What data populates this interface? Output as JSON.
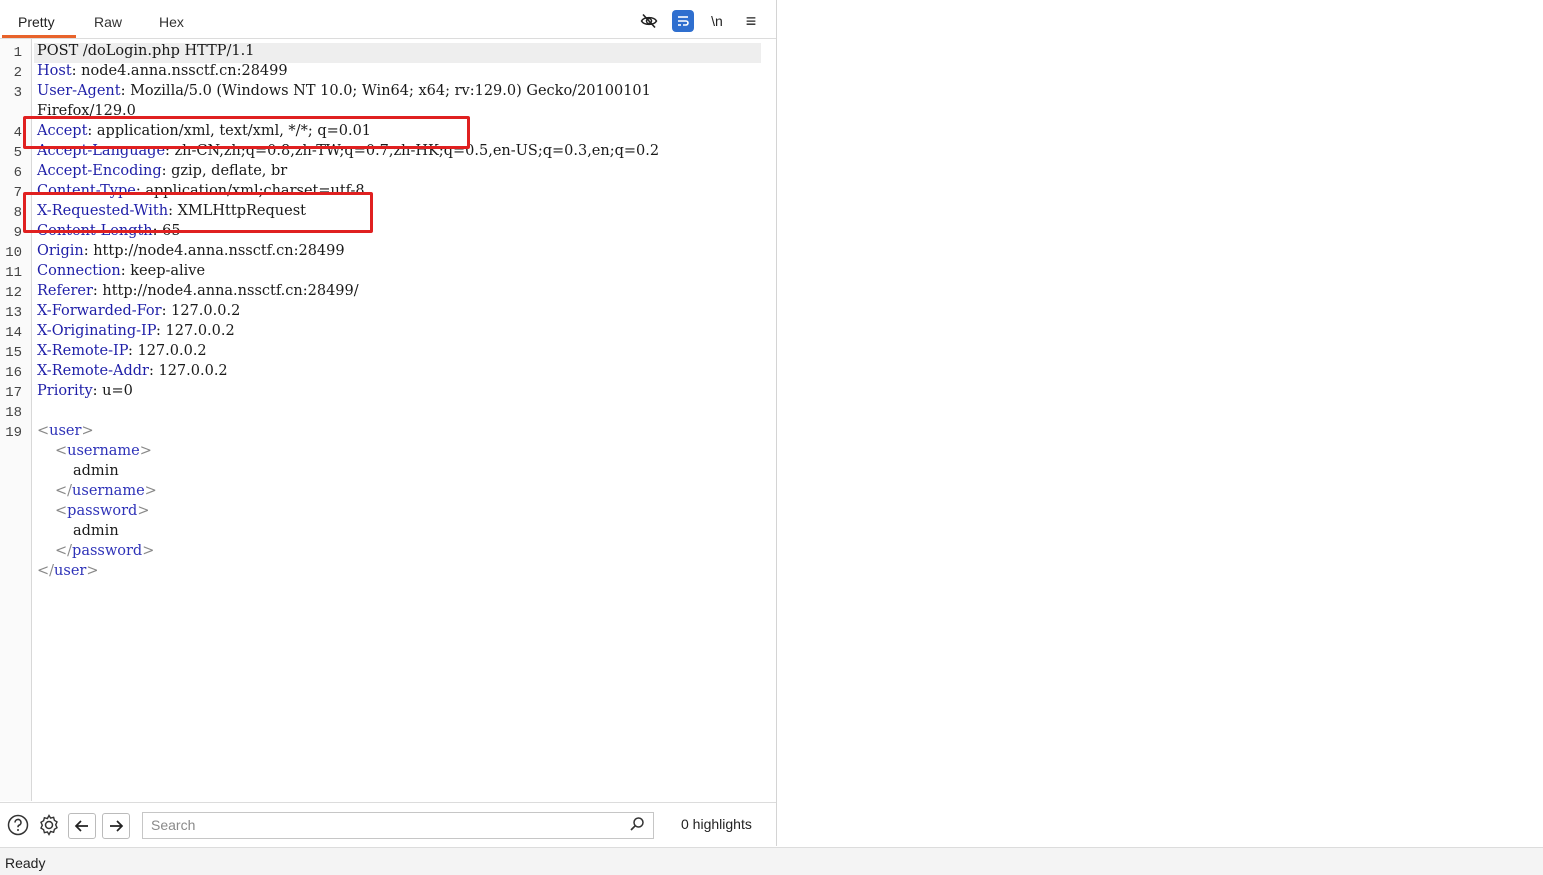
{
  "tabs": [
    {
      "label": "Pretty",
      "active": true
    },
    {
      "label": "Raw",
      "active": false
    },
    {
      "label": "Hex",
      "active": false
    }
  ],
  "toolbar_icons": [
    "eye-off-icon",
    "wrap-lines-icon",
    "newline-icon",
    "menu-icon"
  ],
  "toolbar": {
    "newline_label": "\\n",
    "menu_glyph": "≡"
  },
  "lines": [
    {
      "n": "1",
      "text": "POST /doLogin.php HTTP/1.1"
    },
    {
      "n": "2",
      "key": "Host",
      "val": " node4.anna.nssctf.cn:28499"
    },
    {
      "n": "3",
      "key": "User-Agent",
      "val": " Mozilla/5.0 (Windows NT 10.0; Win64; x64; rv:129.0) Gecko/20100101"
    },
    {
      "n": "",
      "text": "Firefox/129.0"
    },
    {
      "n": "4",
      "key": "Accept",
      "val": " application/xml, text/xml, */*; q=0.01"
    },
    {
      "n": "5",
      "key": "Accept-Language",
      "val": " zh-CN,zh;q=0.8,zh-TW;q=0.7,zh-HK;q=0.5,en-US;q=0.3,en;q=0.2"
    },
    {
      "n": "6",
      "key": "Accept-Encoding",
      "val": " gzip, deflate, br"
    },
    {
      "n": "7",
      "key": "Content-Type",
      "val": " application/xml;charset=utf-8"
    },
    {
      "n": "8",
      "key": "X-Requested-With",
      "val": " XMLHttpRequest"
    },
    {
      "n": "9",
      "key": "Content-Length",
      "val": " 65"
    },
    {
      "n": "10",
      "key": "Origin",
      "val": " http://node4.anna.nssctf.cn:28499"
    },
    {
      "n": "11",
      "key": "Connection",
      "val": " keep-alive"
    },
    {
      "n": "12",
      "key": "Referer",
      "val": " http://node4.anna.nssctf.cn:28499/"
    },
    {
      "n": "13",
      "key": "X-Forwarded-For",
      "val": " 127.0.0.2"
    },
    {
      "n": "14",
      "key": "X-Originating-IP",
      "val": " 127.0.0.2"
    },
    {
      "n": "15",
      "key": "X-Remote-IP",
      "val": " 127.0.0.2"
    },
    {
      "n": "16",
      "key": "X-Remote-Addr",
      "val": " 127.0.0.2"
    },
    {
      "n": "17",
      "key": "Priority",
      "val": " u=0"
    },
    {
      "n": "18",
      "text": ""
    },
    {
      "n": "19",
      "tag": "user",
      "close": false,
      "indent": 0
    },
    {
      "n": "",
      "tag": "username",
      "close": false,
      "indent": 1
    },
    {
      "n": "",
      "text": "admin",
      "indent": 2
    },
    {
      "n": "",
      "tag": "username",
      "close": true,
      "indent": 1
    },
    {
      "n": "",
      "tag": "password",
      "close": false,
      "indent": 1
    },
    {
      "n": "",
      "text": "admin",
      "indent": 2
    },
    {
      "n": "",
      "tag": "password",
      "close": true,
      "indent": 1
    },
    {
      "n": "",
      "tag": "user",
      "close": true,
      "indent": 0
    }
  ],
  "search": {
    "placeholder": "Search"
  },
  "highlights_label": "0 highlights",
  "status_text": "Ready",
  "colors": {
    "accent_tab": "#e8632b",
    "header_key": "#1f1fa8",
    "annotation_box": "#e02020",
    "active_tool": "#2f6fcf"
  }
}
